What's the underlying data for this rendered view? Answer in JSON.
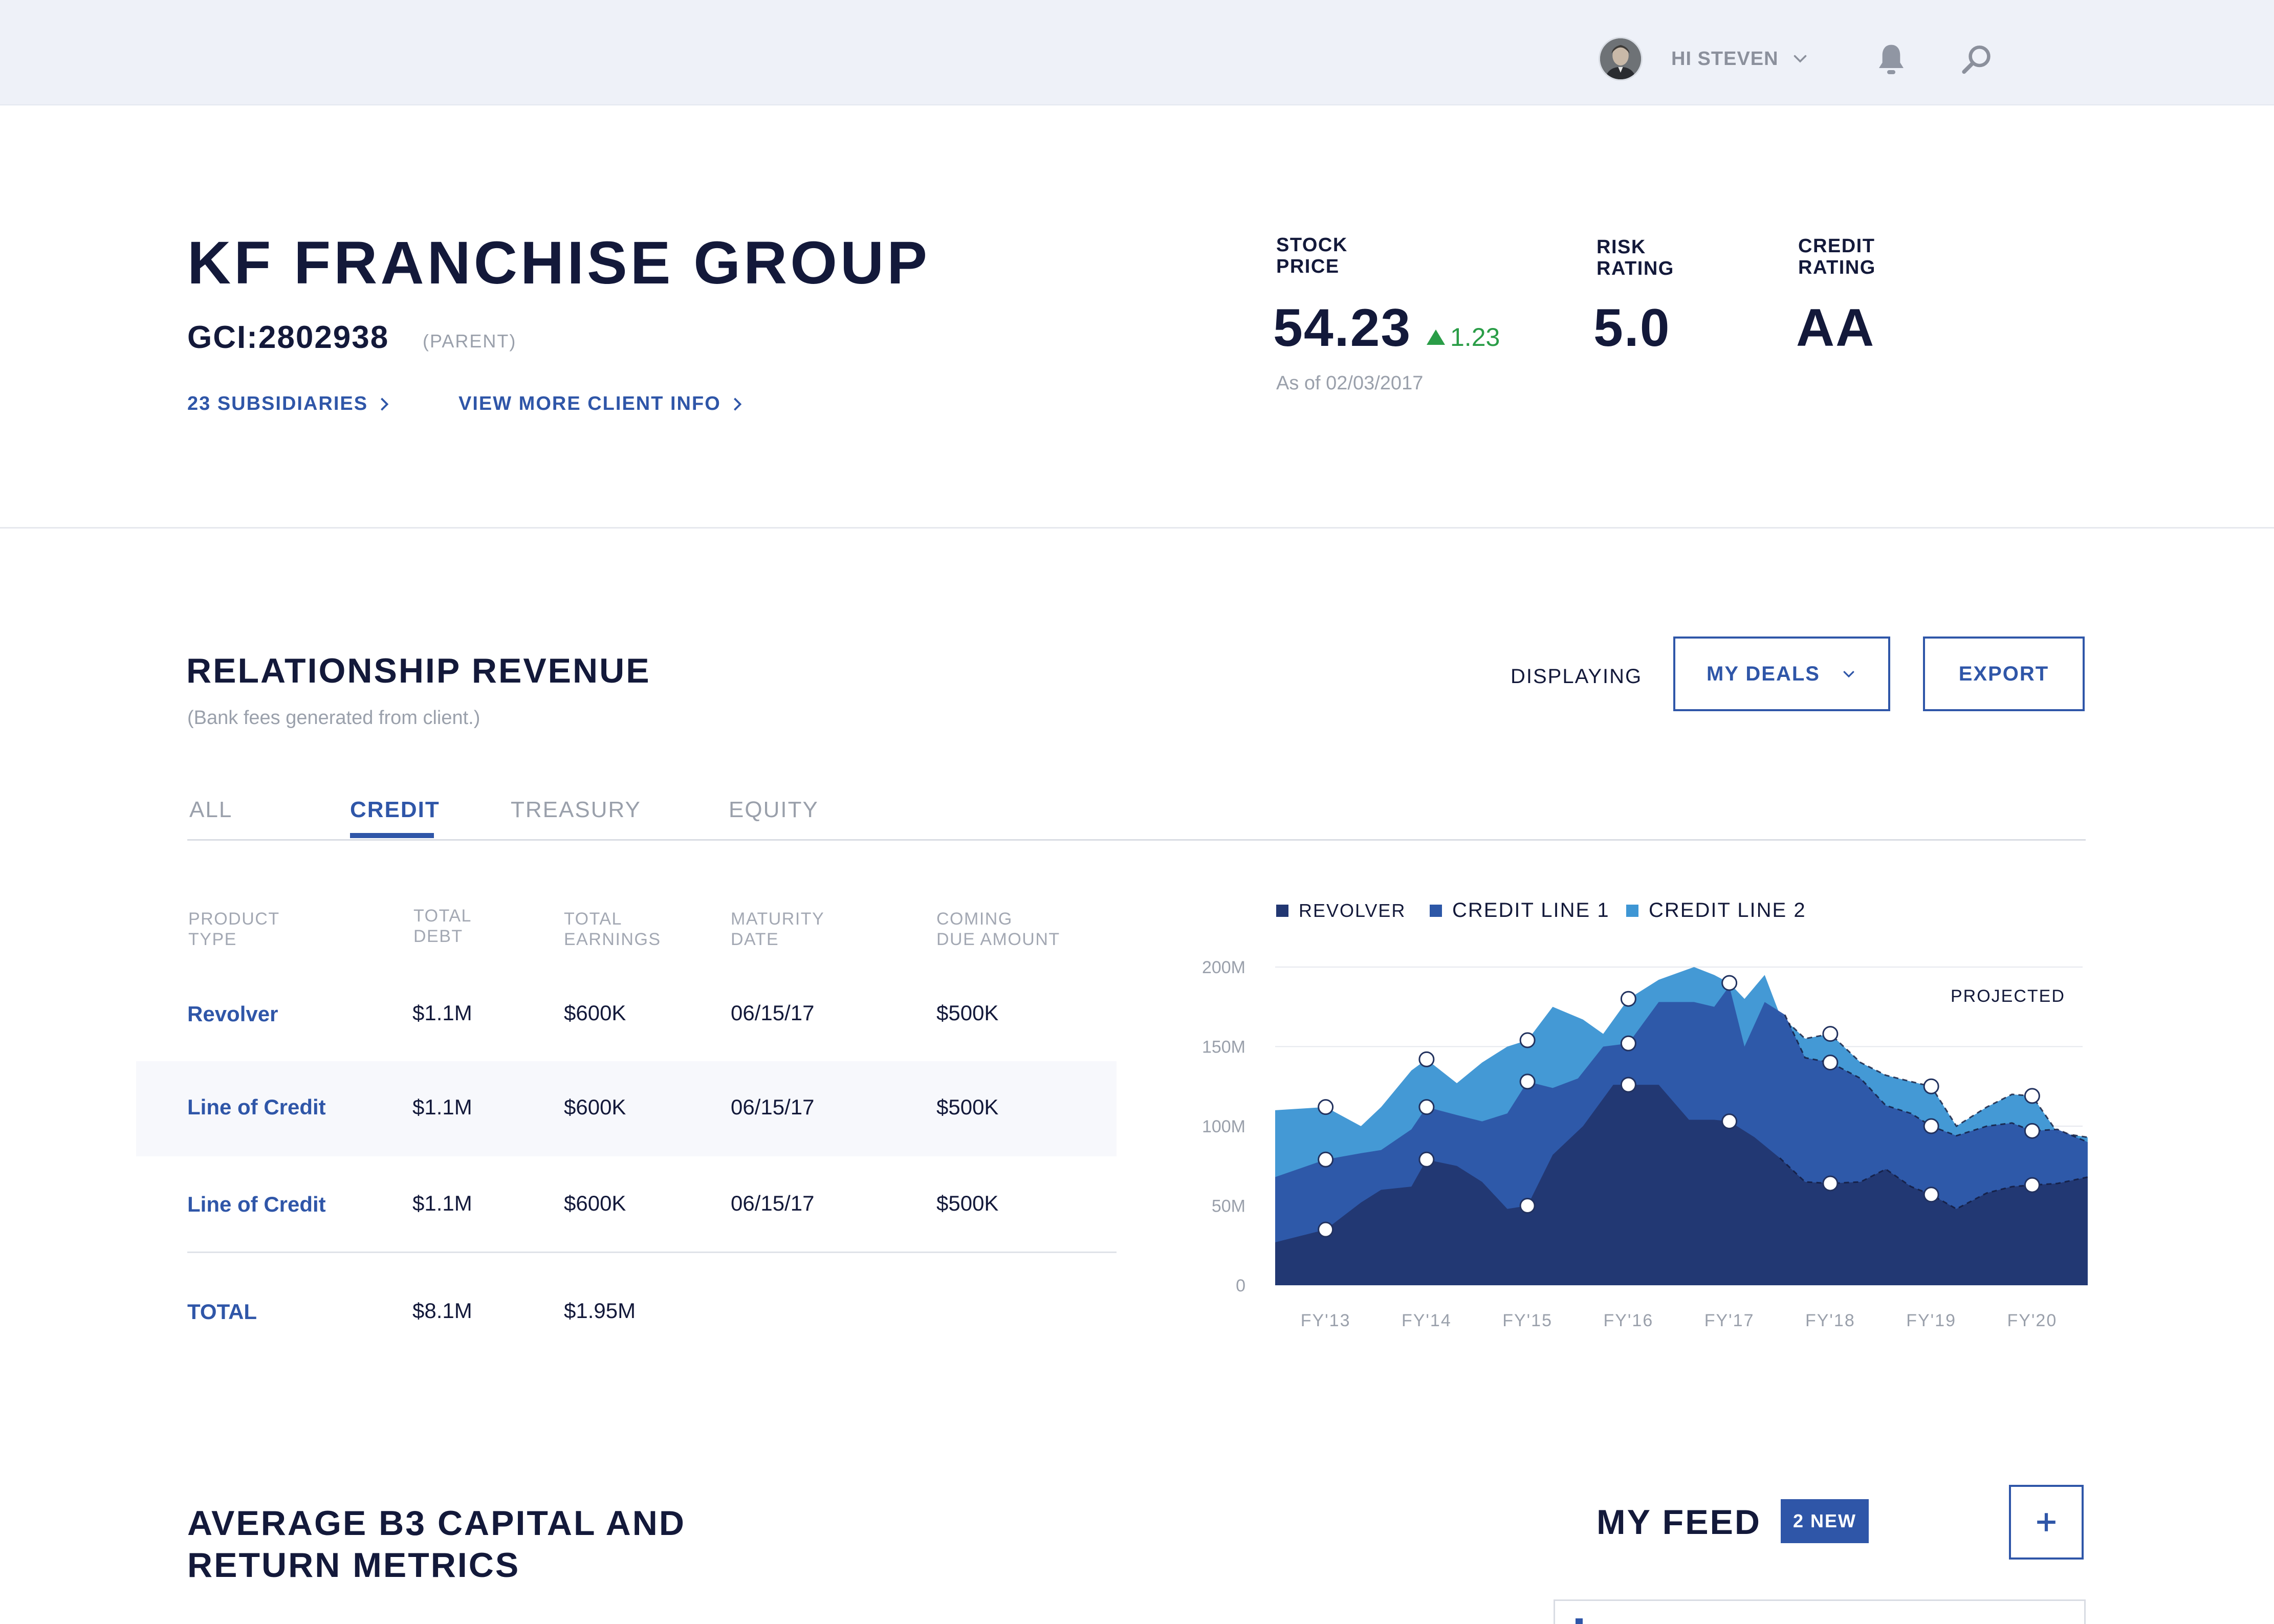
{
  "topbar": {
    "greeting": "HI STEVEN",
    "icons": {
      "avatar": "user-avatar",
      "chevron": "chevron-down-icon",
      "bell": "bell-icon",
      "search": "search-icon"
    }
  },
  "client": {
    "name": "KF FRANCHISE GROUP",
    "gci": "GCI:2802938",
    "parent_label": "(PARENT)",
    "subsidiaries_link": "23 SUBSIDIARIES",
    "more_info_link": "VIEW MORE CLIENT INFO"
  },
  "stats": {
    "stock": {
      "label_line1": "STOCK",
      "label_line2": "PRICE",
      "value": "54.23",
      "change": "1.23",
      "as_of": "As of 02/03/2017"
    },
    "risk": {
      "label_line1": "RISK",
      "label_line2": "RATING",
      "value": "5.0"
    },
    "credit": {
      "label_line1": "CREDIT",
      "label_line2": "RATING",
      "value": "AA"
    }
  },
  "revenue": {
    "title": "RELATIONSHIP REVENUE",
    "subtitle": "(Bank fees generated from client.)",
    "displaying_label": "DISPLAYING",
    "deals_button": "MY DEALS",
    "export_button": "EXPORT",
    "tabs": [
      {
        "label": "ALL",
        "active": false
      },
      {
        "label": "CREDIT",
        "active": true
      },
      {
        "label": "TREASURY",
        "active": false
      },
      {
        "label": "EQUITY",
        "active": false
      }
    ],
    "table": {
      "headers": [
        {
          "line1": "PRODUCT",
          "line2": "TYPE"
        },
        {
          "line1": "TOTAL",
          "line2": "DEBT"
        },
        {
          "line1": "TOTAL",
          "line2": "EARNINGS"
        },
        {
          "line1": "MATURITY",
          "line2": "DATE"
        },
        {
          "line1": "COMING",
          "line2": "DUE AMOUNT"
        }
      ],
      "rows": [
        {
          "product": "Revolver",
          "debt": "$1.1M",
          "earnings": "$600K",
          "maturity": "06/15/17",
          "due": "$500K",
          "highlighted": false
        },
        {
          "product": "Line of Credit",
          "debt": "$1.1M",
          "earnings": "$600K",
          "maturity": "06/15/17",
          "due": "$500K",
          "highlighted": true
        },
        {
          "product": "Line of Credit",
          "debt": "$1.1M",
          "earnings": "$600K",
          "maturity": "06/15/17",
          "due": "$500K",
          "highlighted": false
        }
      ],
      "total": {
        "label": "TOTAL",
        "debt": "$8.1M",
        "earnings": "$1.95M"
      }
    }
  },
  "chart_data": {
    "type": "area",
    "stacked": true,
    "categories": [
      "FY'13",
      "FY'14",
      "FY'15",
      "FY'16",
      "FY'17",
      "FY'18",
      "FY'19",
      "FY'20"
    ],
    "y_ticks": [
      "0",
      "50M",
      "100M",
      "150M",
      "200M"
    ],
    "ylim": [
      0,
      200
    ],
    "annotation": "PROJECTED",
    "projected_from": 4.5,
    "grid": true,
    "legend_position": "top-left",
    "series": [
      {
        "name": "REVOLVER",
        "color": "#223772",
        "x": [
          -0.5,
          0,
          0.35,
          0.55,
          0.85,
          1,
          1.3,
          1.55,
          1.8,
          2,
          2.25,
          2.55,
          2.85,
          3,
          3.3,
          3.6,
          3.85,
          4,
          4.25,
          4.5,
          4.75,
          5,
          5.3,
          5.55,
          5.8,
          6,
          6.25,
          6.55,
          6.8,
          7,
          7.25,
          7.55
        ],
        "values": [
          27,
          35,
          52,
          60,
          62,
          79,
          75,
          65,
          48,
          50,
          82,
          100,
          126,
          126,
          126,
          104,
          104,
          103,
          93,
          80,
          65,
          64,
          65,
          73,
          62,
          57,
          48,
          58,
          62,
          63,
          64,
          68
        ]
      },
      {
        "name": "CREDIT LINE 1",
        "color": "#2d57a7",
        "x": [
          -0.5,
          0,
          0.35,
          0.55,
          0.85,
          1,
          1.3,
          1.55,
          1.8,
          2,
          2.25,
          2.5,
          2.75,
          3,
          3.3,
          3.65,
          3.85,
          4,
          4.15,
          4.35,
          4.55,
          4.75,
          5,
          5.3,
          5.55,
          5.8,
          6,
          6.25,
          6.55,
          6.8,
          7,
          7.25,
          7.55
        ],
        "values": [
          68,
          79,
          83,
          85,
          98,
          112,
          107,
          103,
          108,
          128,
          124,
          130,
          150,
          152,
          178,
          178,
          175,
          188,
          150,
          178,
          170,
          143,
          140,
          130,
          113,
          108,
          100,
          94,
          100,
          102,
          97,
          98,
          90
        ]
      },
      {
        "name": "CREDIT LINE 2",
        "color": "#3e96d4",
        "x": [
          -0.5,
          0,
          0.35,
          0.55,
          0.85,
          1,
          1.3,
          1.55,
          1.8,
          2,
          2.25,
          2.55,
          2.75,
          3,
          3.3,
          3.65,
          3.85,
          4,
          4.15,
          4.35,
          4.5,
          4.75,
          5,
          5.3,
          5.55,
          5.8,
          6,
          6.25,
          6.55,
          6.8,
          7,
          7.25,
          7.55
        ],
        "values": [
          110,
          112,
          100,
          112,
          135,
          142,
          127,
          140,
          150,
          154,
          175,
          167,
          158,
          180,
          192,
          200,
          195,
          190,
          180,
          195,
          170,
          155,
          158,
          140,
          132,
          128,
          125,
          100,
          112,
          120,
          119,
          96,
          93
        ]
      }
    ],
    "markers": [
      {
        "series": 0,
        "x": [
          0,
          1,
          2,
          3,
          4,
          5,
          6,
          7
        ]
      },
      {
        "series": 1,
        "x": [
          0,
          1,
          2,
          3,
          5,
          6,
          7
        ]
      },
      {
        "series": 2,
        "x": [
          0,
          1,
          2,
          3,
          4,
          5,
          6,
          7
        ]
      }
    ]
  },
  "bottom": {
    "metrics_title_line1": "AVERAGE B3 CAPITAL AND",
    "metrics_title_line2": "RETURN METRICS",
    "feed_title": "MY FEED",
    "feed_badge": "2 NEW",
    "add_icon": "plus-icon"
  },
  "colors": {
    "accent": "#2f56a8",
    "positive": "#2a9d47",
    "topbar": "#eef1f8",
    "text": "#13193a",
    "muted": "#9aa0ab"
  }
}
